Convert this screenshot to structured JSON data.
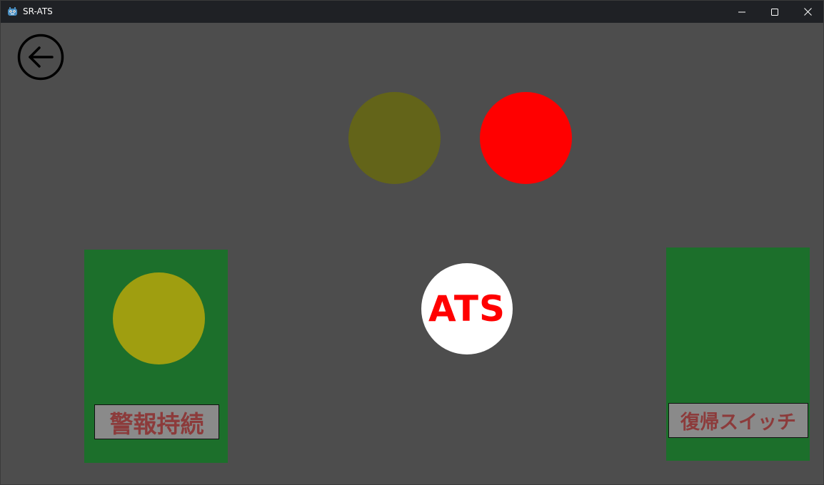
{
  "window": {
    "title": "SR-ATS",
    "app_icon": "godot-robot-icon",
    "controls": {
      "minimize_icon": "minimize-icon",
      "maximize_icon": "maximize-icon",
      "close_icon": "close-icon"
    }
  },
  "toolbar": {
    "back_icon": "arrow-left-circle-icon"
  },
  "indicators": {
    "top_left_lamp_color": "#636419",
    "top_right_lamp_color": "#ff0000"
  },
  "ats": {
    "label": "ATS",
    "background": "#ffffff",
    "text_color": "#ff0000"
  },
  "warning_panel": {
    "label": "警報持続",
    "panel_color": "#1c6f2b",
    "lamp_color": "#9f9e10",
    "label_bg": "#8a8a8a",
    "label_color": "#8c3b3b"
  },
  "reset_panel": {
    "label": "復帰スイッチ",
    "panel_color": "#1c6f2b",
    "label_bg": "#8a8a8a",
    "label_color": "#8c3b3b"
  },
  "colors": {
    "background": "#4d4d4d",
    "titlebar": "#1f2125"
  }
}
